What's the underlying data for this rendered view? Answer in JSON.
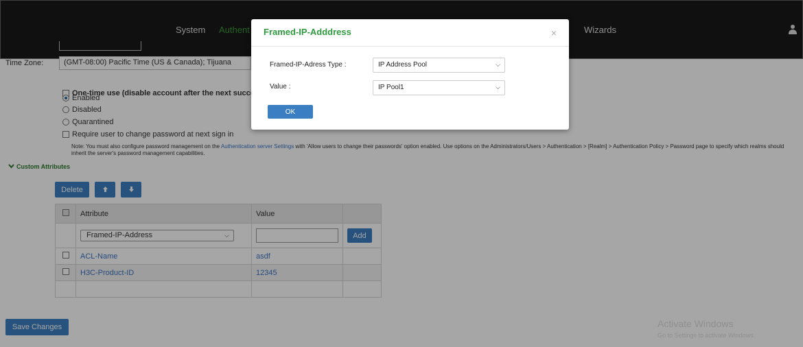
{
  "nav": {
    "items": [
      "System",
      "Authent",
      "Wizards"
    ]
  },
  "form": {
    "timezone_label": "Time Zone:",
    "timezone_value": "(GMT-08:00) Pacific Time (US & Canada); Tijuana",
    "one_time_use": "One-time use (disable account after the next successfu",
    "enabled": "Enabled",
    "disabled": "Disabled",
    "quarantined": "Quarantined",
    "require_change": "Require user to change password at next sign in",
    "note_prefix": "Note: You must also configure password management on the ",
    "note_link": "Authentication server Settings",
    "note_suffix": " with 'Allow users to change their passwords' option enabled. Use options on the Administrators/Users > Authentication > [Realm] > Authentication Policy > Password page to specify which realms should inherit the server's password management capabilities."
  },
  "custom_attributes": {
    "title": "Custom Attributes",
    "delete_label": "Delete",
    "up_icon": "arrow-up-icon",
    "down_icon": "arrow-down-icon",
    "columns": [
      "Attribute",
      "Value"
    ],
    "new_attribute": "Framed-IP-Address",
    "add_label": "Add",
    "rows": [
      {
        "attribute": "ACL-Name",
        "value": "asdf"
      },
      {
        "attribute": "H3C-Product-ID",
        "value": "12345"
      }
    ]
  },
  "save_label": "Save Changes",
  "watermark": {
    "line1": "Activate Windows",
    "line2": "Go to Settings to activate Windows."
  },
  "modal": {
    "title": "Framed-IP-Adddress",
    "close": "×",
    "type_label": "Framed-IP-Adress Type :",
    "type_value": "IP Address Pool",
    "value_label": "Value :",
    "value_value": "IP Pool1",
    "ok_label": "OK"
  },
  "colors": {
    "accent_green": "#2e9b3e",
    "button_blue": "#3b7ec1",
    "link_blue": "#3b73c4"
  }
}
